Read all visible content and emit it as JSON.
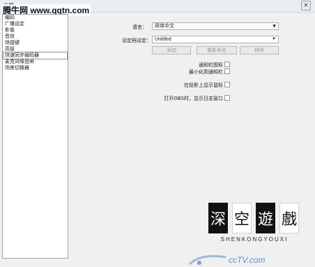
{
  "window": {
    "title": "设置",
    "close_glyph": "×"
  },
  "watermark_top": "腾牛网 www.qqtn.com",
  "sidebar": {
    "items": [
      {
        "label": "编码"
      },
      {
        "label": "广播设定"
      },
      {
        "label": "影像"
      },
      {
        "label": "音效"
      },
      {
        "label": "快捷键"
      },
      {
        "label": "高级"
      },
      {
        "label": "快速同步编码器"
      },
      {
        "label": "麦克风噪音闸"
      },
      {
        "label": "场景切换器"
      }
    ],
    "selected_index": 6
  },
  "settings": {
    "language_label": "语言：",
    "language_value": "简体中文",
    "profile_label": "设定档设定：",
    "profile_value": "Untitled",
    "buttons": {
      "add": "添加",
      "rename": "重新命名",
      "remove": "移除"
    },
    "checkboxes": [
      {
        "label": "通知栏图标",
        "checked": false
      },
      {
        "label": "最小化到通知栏",
        "checked": false
      },
      {
        "label": "在投影上显示鼠标",
        "checked": false
      },
      {
        "label": "打开OBS时，显示日志窗口",
        "checked": false
      }
    ]
  },
  "logo": {
    "chars": [
      "深",
      "空",
      "遊",
      "戲"
    ],
    "styles": [
      "dark",
      "light",
      "dark",
      "light"
    ],
    "subtitle": "SHENKONGYOUXI"
  },
  "watermark_bottom": "ccTV.com"
}
